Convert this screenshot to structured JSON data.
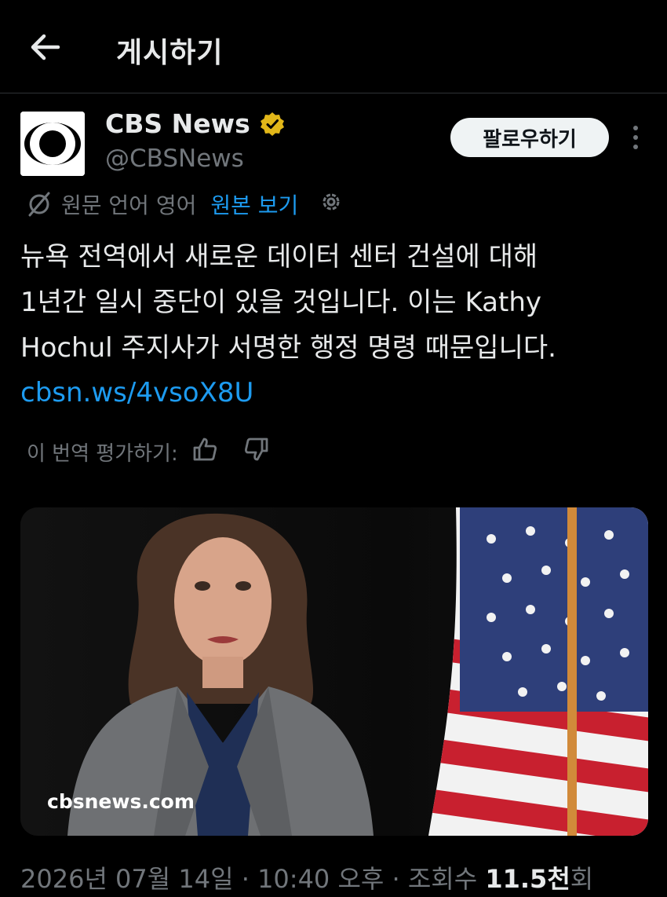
{
  "header": {
    "title": "게시하기"
  },
  "post": {
    "author_name": "CBS News",
    "author_handle": "@CBSNews",
    "follow_label": "팔로우하기",
    "lang_note": "원문 언어 영어",
    "show_original_label": "원본 보기",
    "body_lines": [
      "뉴욕 전역에서 새로운 데이터 센터 건설에 대해",
      "1년간 일시 중단이 있을 것입니다. 이는 Kathy",
      "Hochul 주지사가 서명한 행정 명령 때문입니다."
    ],
    "link": "cbsn.ws/4vsoX8U",
    "rate_label": "이 번역 평가하기:",
    "media_watermark": "cbsnews.com",
    "date": "2026년 07월 14일",
    "separator": "·",
    "time": "10:40 오후",
    "views_label": "조회수",
    "views_count": "11.5천",
    "views_suffix": "회"
  },
  "icons": {
    "back": "arrow-left-icon",
    "verified": "verified-badge-icon",
    "more": "more-vertical-icon",
    "translate": "translate-icon",
    "settings": "gear-icon",
    "thumbs_up": "thumbs-up-icon",
    "thumbs_down": "thumbs-down-icon"
  },
  "colors": {
    "background": "#000000",
    "link": "#1d9bf0",
    "muted": "#71767b",
    "verified": "#e2b719",
    "follow_bg": "#eff3f4"
  }
}
